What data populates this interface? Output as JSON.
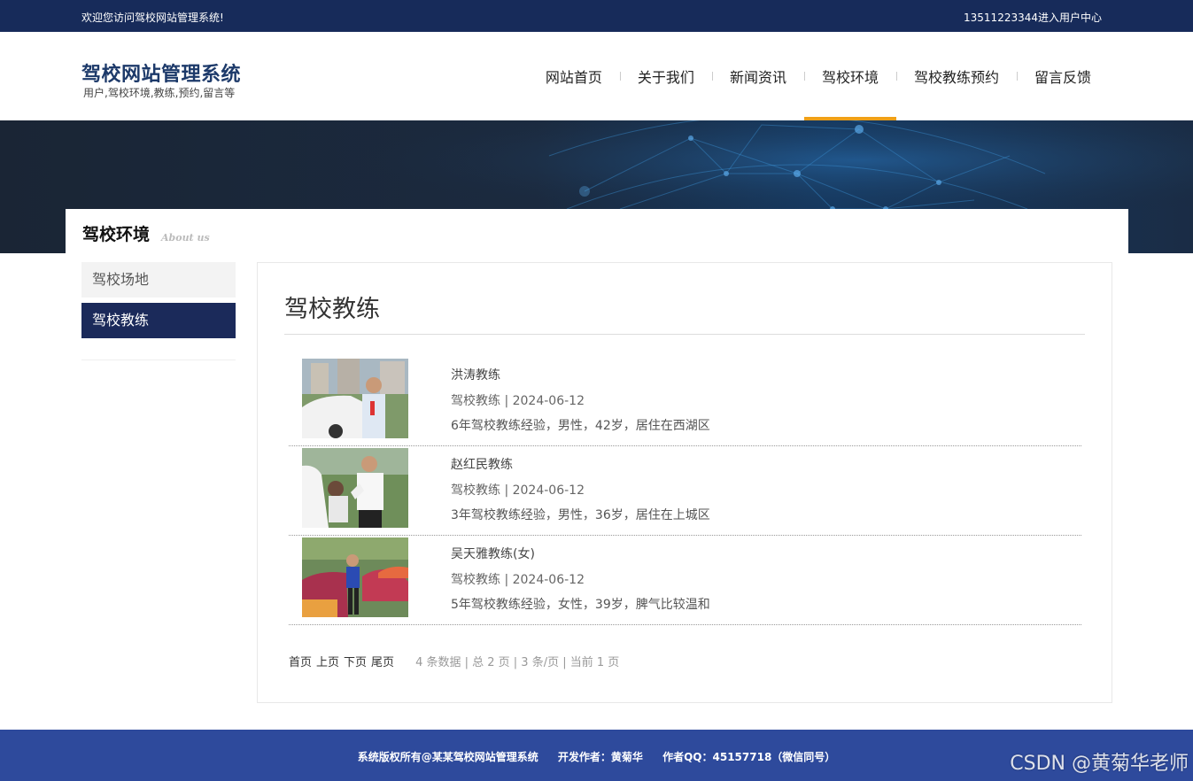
{
  "topbar": {
    "welcome": "欢迎您访问驾校网站管理系统!",
    "user_center": "13511223344进入用户中心"
  },
  "header": {
    "logo_title": "驾校网站管理系统",
    "logo_subtitle": "用户,驾校环境,教练,预约,留言等"
  },
  "nav": {
    "items": [
      {
        "label": "网站首页"
      },
      {
        "label": "关于我们"
      },
      {
        "label": "新闻资讯"
      },
      {
        "label": "驾校环境"
      },
      {
        "label": "驾校教练预约"
      },
      {
        "label": "留言反馈"
      }
    ],
    "active": "驾校环境",
    "active_color": "#f0a017"
  },
  "section": {
    "title": "驾校环境",
    "subtitle_en": "About us"
  },
  "sidebar": {
    "items": [
      {
        "label": "驾校场地"
      },
      {
        "label": "驾校教练"
      }
    ],
    "active": "驾校教练"
  },
  "content": {
    "title": "驾校教练",
    "items": [
      {
        "title": "洪涛教练",
        "meta": "驾校教练 | 2024-06-12",
        "desc": "6年驾校教练经验，男性，42岁，居住在西湖区"
      },
      {
        "title": "赵红民教练",
        "meta": "驾校教练 | 2024-06-12",
        "desc": "3年驾校教练经验，男性，36岁，居住在上城区"
      },
      {
        "title": "吴天雅教练(女)",
        "meta": "驾校教练 | 2024-06-12",
        "desc": "5年驾校教练经验，女性，39岁，脾气比较温和"
      }
    ]
  },
  "pager": {
    "first": "首页",
    "prev": "上页",
    "next": "下页",
    "last": "尾页",
    "info": "4 条数据 | 总 2 页 | 3 条/页 | 当前 1 页"
  },
  "footer": {
    "copyright": "系统版权所有@某某驾校网站管理系统",
    "author": "开发作者：黄菊华",
    "qq": "作者QQ：45157718（微信同号）"
  },
  "watermark": "CSDN @黄菊华老师",
  "colors": {
    "topbar": "#172b5a",
    "footer": "#2e4a9c",
    "sidebar_active": "#1b2a5a"
  }
}
